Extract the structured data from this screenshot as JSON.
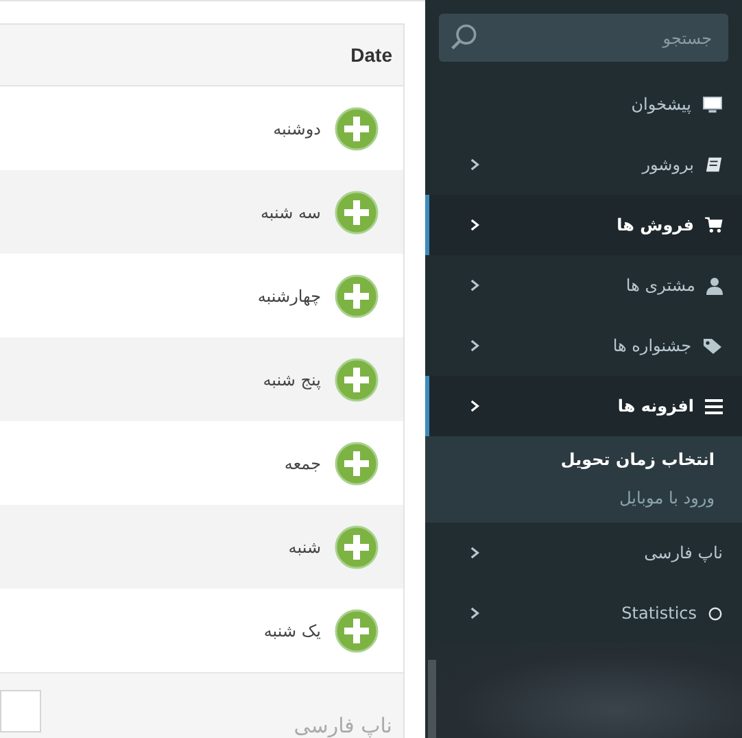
{
  "table": {
    "columns": [
      "Date"
    ],
    "rows": [
      {
        "date": "دوشنبه"
      },
      {
        "date": "سه شنبه"
      },
      {
        "date": "چهارشنبه"
      },
      {
        "date": "پنج شنبه"
      },
      {
        "date": "جمعه"
      },
      {
        "date": "شنبه"
      },
      {
        "date": "یک شنبه"
      }
    ],
    "footer": {
      "checked": false,
      "label": "ناپ فارسی"
    }
  },
  "sidebar": {
    "search": {
      "placeholder": "جستجو"
    },
    "items": [
      {
        "label": "پیشخوان",
        "kind": "monitor",
        "has_submenu": false,
        "selected": false
      },
      {
        "label": "بروشور",
        "kind": "book",
        "has_submenu": true,
        "selected": false
      },
      {
        "label": "فروش ها",
        "kind": "cart",
        "has_submenu": true,
        "selected": true
      },
      {
        "label": "مشتری ها",
        "kind": "user",
        "has_submenu": true,
        "selected": false
      },
      {
        "label": "جشنواره ها",
        "kind": "tags",
        "has_submenu": true,
        "selected": false
      },
      {
        "label": "افزونه ها",
        "kind": "bars",
        "has_submenu": true,
        "selected": true,
        "children": [
          {
            "label": "انتخاب زمان تحویل",
            "selected": true
          },
          {
            "label": "ورود با موبایل",
            "selected": false
          }
        ]
      },
      {
        "label": "ناپ فارسی",
        "kind": "plain",
        "has_submenu": true,
        "selected": false
      },
      {
        "label": "Statistics",
        "kind": "circle",
        "has_submenu": true,
        "selected": false
      }
    ]
  }
}
